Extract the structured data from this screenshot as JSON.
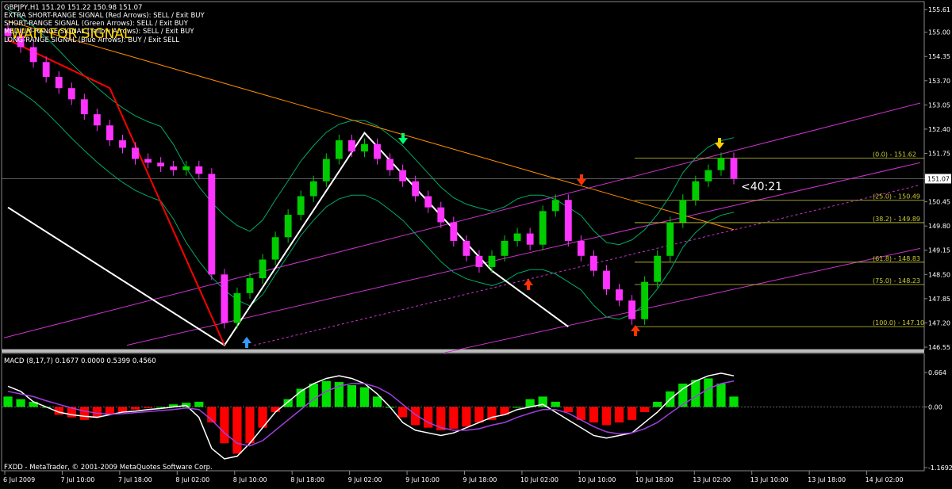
{
  "window": {
    "symbol_line": "GBPJPY,H1  151.20 151.22 150.98 151.07",
    "wait_signal": "WAIT FOR SIGNAL",
    "signal_lines": [
      "EXTRA SHORT-RANGE SIGNAL (Red Arrows): SELL / Exit BUY",
      "SHORT-RANGE SIGNAL (Green Arrows): SELL / Exit BUY",
      "MEDIUM-RANGE SIGNAL (Yellow Arrows): SELL / Exit BUY",
      "LONG-RANGE SIGNAL (Blue Arrows): BUY / Exit SELL"
    ],
    "countdown": "<40:21",
    "copyright": "FXDD - MetaTrader, © 2001-2009 MetaQuotes Software Corp."
  },
  "colors": {
    "background": "#000000",
    "bull_candle": "#00cc00",
    "bear_candle": "#ff33ff",
    "zigzag_white": "#ffffff",
    "zigzag_red": "#ff0000",
    "bands": "#00aa66",
    "slow_ma": "#ff8c00",
    "channel": "#cc33cc",
    "fib": "#cccc33",
    "macd_pos": "#00e000",
    "macd_neg": "#ff0000",
    "macd_line": "#ffffff",
    "signal_line": "#a040e0",
    "arrow_blue": "#3399ff",
    "arrow_red": "#ff3300",
    "arrow_green": "#00ff66",
    "arrow_yellow": "#ffcc00"
  },
  "chart_data": {
    "type": "candlestick",
    "price_axis": {
      "min": 146.55,
      "max": 155.61,
      "ticks": [
        "155.61",
        "155.00",
        "154.35",
        "153.70",
        "153.05",
        "152.40",
        "151.75",
        "151.07",
        "150.45",
        "149.80",
        "149.15",
        "148.50",
        "147.85",
        "147.20",
        "146.55"
      ],
      "current_price": "151.07"
    },
    "time_axis": {
      "ticks": [
        "6 Jul 2009",
        "7 Jul 10:00",
        "7 Jul 18:00",
        "8 Jul 02:00",
        "8 Jul 10:00",
        "8 Jul 18:00",
        "9 Jul 02:00",
        "9 Jul 10:00",
        "9 Jul 18:00",
        "10 Jul 02:00",
        "10 Jul 10:00",
        "10 Jul 18:00",
        "13 Jul 02:00",
        "13 Jul 10:00",
        "13 Jul 18:00",
        "14 Jul 02:00"
      ]
    },
    "close_path": [
      154.9,
      154.6,
      154.2,
      153.8,
      153.5,
      153.2,
      152.8,
      152.5,
      152.1,
      151.9,
      151.6,
      151.5,
      151.4,
      151.3,
      151.4,
      151.2,
      148.5,
      147.2,
      148.0,
      148.4,
      148.9,
      149.5,
      150.1,
      150.6,
      151.0,
      151.6,
      152.1,
      151.8,
      152.0,
      151.6,
      151.3,
      151.0,
      150.6,
      150.3,
      149.9,
      149.4,
      149.0,
      148.7,
      149.0,
      149.4,
      149.6,
      149.3,
      150.2,
      150.5,
      149.4,
      149.0,
      148.6,
      148.1,
      147.8,
      147.3,
      148.3,
      149.0,
      149.9,
      150.5,
      151.0,
      151.3,
      151.62,
      151.07
    ],
    "fibonacci": [
      {
        "label": "(0.0) - 151.62",
        "price": 151.62
      },
      {
        "label": "(25.0) - 150.49",
        "price": 150.49
      },
      {
        "label": "(38.2) - 149.89",
        "price": 149.89
      },
      {
        "label": "(61.8) - 148.83",
        "price": 148.83
      },
      {
        "label": "(75.0) - 148.23",
        "price": 148.23
      },
      {
        "label": "(100.0) - 147.10",
        "price": 147.1
      }
    ],
    "zigzag_white": [
      [
        0,
        150.3
      ],
      [
        17,
        146.6
      ],
      [
        28,
        152.3
      ],
      [
        38,
        148.6
      ],
      [
        44,
        147.1
      ]
    ],
    "zigzag_red": [
      [
        0,
        154.8
      ],
      [
        8,
        153.5
      ],
      [
        17,
        146.6
      ]
    ],
    "macd": {
      "title": "MACD  (8,17,7) 0.1677 0.0000 0.5399 0.4560",
      "axis_ticks": [
        "0.664",
        "0.00",
        "-1.1692"
      ],
      "min": -1.1692,
      "max": 0.664,
      "histogram": [
        0.2,
        0.15,
        0.1,
        0.0,
        -0.15,
        -0.2,
        -0.25,
        -0.2,
        -0.15,
        -0.1,
        -0.05,
        -0.02,
        0.0,
        0.05,
        0.08,
        0.1,
        -0.3,
        -0.7,
        -0.9,
        -0.7,
        -0.4,
        -0.1,
        0.15,
        0.35,
        0.45,
        0.5,
        0.48,
        0.42,
        0.38,
        0.2,
        0.0,
        -0.2,
        -0.35,
        -0.4,
        -0.45,
        -0.42,
        -0.38,
        -0.3,
        -0.25,
        -0.15,
        0.0,
        0.15,
        0.2,
        0.1,
        -0.1,
        -0.25,
        -0.3,
        -0.35,
        -0.3,
        -0.25,
        -0.1,
        0.1,
        0.3,
        0.45,
        0.52,
        0.55,
        0.45,
        0.2
      ],
      "macd_line": [
        0.4,
        0.3,
        0.1,
        0.0,
        -0.1,
        -0.15,
        -0.18,
        -0.2,
        -0.15,
        -0.1,
        -0.08,
        -0.05,
        -0.03,
        0.0,
        0.03,
        -0.2,
        -0.8,
        -1.0,
        -0.95,
        -0.7,
        -0.4,
        -0.1,
        0.1,
        0.3,
        0.45,
        0.55,
        0.6,
        0.55,
        0.45,
        0.25,
        0.0,
        -0.3,
        -0.45,
        -0.5,
        -0.55,
        -0.5,
        -0.4,
        -0.3,
        -0.2,
        -0.15,
        -0.05,
        0.0,
        0.05,
        -0.1,
        -0.25,
        -0.4,
        -0.55,
        -0.6,
        -0.55,
        -0.5,
        -0.3,
        -0.1,
        0.15,
        0.35,
        0.5,
        0.6,
        0.65,
        0.6
      ],
      "signal_line": [
        0.3,
        0.25,
        0.2,
        0.12,
        0.05,
        -0.02,
        -0.08,
        -0.12,
        -0.14,
        -0.13,
        -0.11,
        -0.09,
        -0.07,
        -0.05,
        -0.02,
        -0.05,
        -0.25,
        -0.5,
        -0.7,
        -0.75,
        -0.65,
        -0.45,
        -0.25,
        -0.05,
        0.15,
        0.3,
        0.4,
        0.45,
        0.45,
        0.38,
        0.25,
        0.05,
        -0.15,
        -0.3,
        -0.4,
        -0.45,
        -0.45,
        -0.42,
        -0.35,
        -0.3,
        -0.2,
        -0.12,
        -0.05,
        -0.05,
        -0.12,
        -0.25,
        -0.38,
        -0.48,
        -0.52,
        -0.5,
        -0.42,
        -0.3,
        -0.12,
        0.05,
        0.2,
        0.35,
        0.45,
        0.5
      ]
    }
  }
}
